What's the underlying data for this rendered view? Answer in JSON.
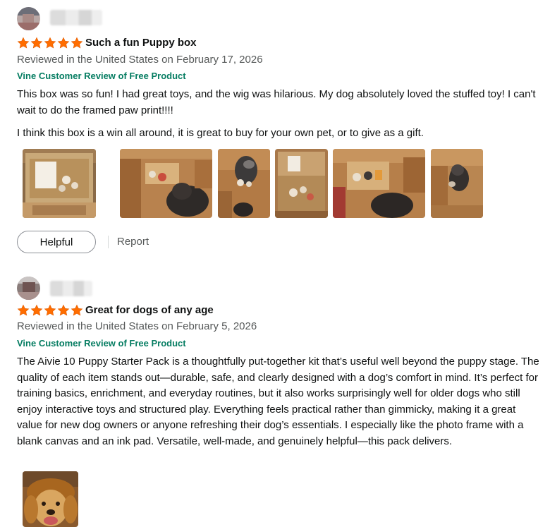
{
  "reviews": [
    {
      "rating": 5,
      "title": "Such a fun Puppy box",
      "meta": "Reviewed in the United States on February 17, 2026",
      "vine": "Vine Customer Review of Free Product",
      "paragraphs": [
        "This box was so fun! I had great toys, and the wig was hilarious. My dog absolutely loved the stuffed toy! I can't wait to do the framed paw print!!!!",
        "I think this box is a win all around, it is great to buy for your own pet, or to give as a gift."
      ],
      "images": [
        "box-open-photo",
        "dog-with-toys-photo",
        "dog-standing-photo",
        "box-contents-photo",
        "box-with-dog-photo",
        "dog-sitting-photo"
      ],
      "helpful_label": "Helpful",
      "report_label": "Report"
    },
    {
      "rating": 5,
      "title": "Great for dogs of any age",
      "meta": "Reviewed in the United States on February 5, 2026",
      "vine": "Vine Customer Review of Free Product",
      "paragraphs": [
        "The Aivie 10 Puppy Starter Pack is a thoughtfully put-together kit that’s useful well beyond the puppy stage. The quality of each item stands out—durable, safe, and clearly designed with a dog’s comfort in mind. It’s perfect for training basics, enrichment, and everyday routines, but it also works surprisingly well for older dogs who still enjoy interactive toys and structured play. Everything feels practical rather than gimmicky, making it a great value for new dog owners or anyone refreshing their dog’s essentials. I especially like the photo frame with a blank canvas and an ink pad. Versatile, well-made, and genuinely helpful—this pack delivers."
      ],
      "images": [
        "golden-retriever-wig-photo"
      ]
    }
  ],
  "colors": {
    "star": "#ff6d00",
    "vine": "#067d62",
    "meta": "#565959",
    "text": "#0f1111"
  }
}
